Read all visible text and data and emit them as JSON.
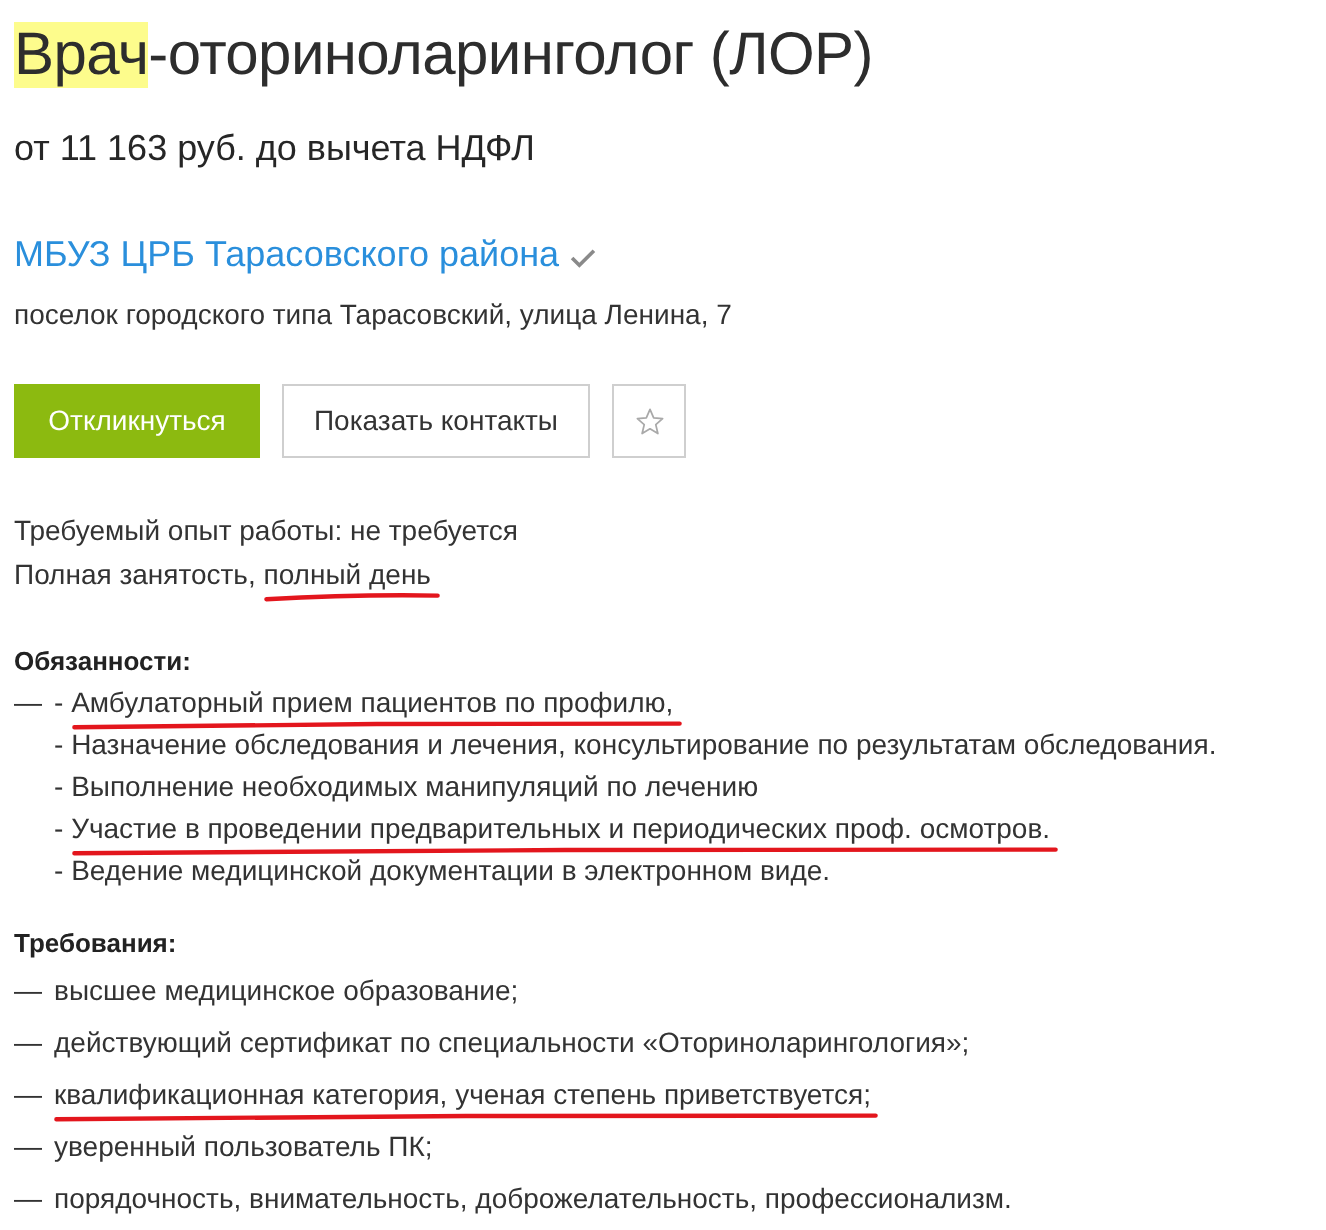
{
  "title": [
    {
      "text": "Врач",
      "highlighted": true
    },
    {
      "text": "-оториноларинголог (ЛОР)",
      "highlighted": false
    }
  ],
  "salary": "от 11 163 руб. до вычета НДФЛ",
  "company": {
    "name": "МБУЗ ЦРБ Тарасовского района",
    "verified": true
  },
  "address": "поселок городского типа Тарасовский, улица Ленина, 7",
  "buttons": [
    {
      "kind": "primary",
      "label": "Откликнуться"
    },
    {
      "kind": "secondary",
      "label": "Показать контакты"
    },
    {
      "kind": "favorite"
    }
  ],
  "conditions": [
    {
      "segments": [
        {
          "text": "Требуемый опыт работы: не требуется",
          "underlined": false
        }
      ]
    },
    {
      "segments": [
        {
          "text": "Полная занятость,",
          "underlined": false
        },
        {
          "text": "полный день",
          "underlined": true
        }
      ]
    }
  ],
  "duties": {
    "heading": "Обязанности:",
    "items": [
      {
        "marker": "—",
        "lines": [
          {
            "dash": "-",
            "text": "Амбулаторный прием пациентов по профилю,",
            "underlined": true
          },
          {
            "dash": "-",
            "text": "Назначение обследования и лечения, консультирование по результатам обследования.",
            "underlined": false
          },
          {
            "dash": "-",
            "text": "Выполнение необходимых манипуляций по лечению",
            "underlined": false
          },
          {
            "dash": "-",
            "text": "Участие в проведении предварительных и периодических проф. осмотров.",
            "underlined": true
          },
          {
            "dash": "-",
            "text": "Ведение медицинской документации в электронном виде.",
            "underlined": false
          }
        ]
      }
    ]
  },
  "requirements": {
    "heading": "Требования:",
    "items": [
      {
        "marker": "—",
        "lines": [
          {
            "text": "высшее медицинское образование;",
            "underlined": false
          }
        ]
      },
      {
        "marker": "—",
        "lines": [
          {
            "text": "действующий сертификат по специальности «Оториноларингология»;",
            "underlined": false
          }
        ]
      },
      {
        "marker": "—",
        "lines": [
          {
            "text": "квалификационная категория, ученая степень приветствуется;",
            "underlined": true
          }
        ]
      },
      {
        "marker": "—",
        "lines": [
          {
            "text": "уверенный пользователь ПК;",
            "underlined": false
          }
        ]
      },
      {
        "marker": "—",
        "lines": [
          {
            "text": "порядочность, внимательность, доброжелательность, профессионализм.",
            "underlined": false
          }
        ]
      }
    ]
  }
}
